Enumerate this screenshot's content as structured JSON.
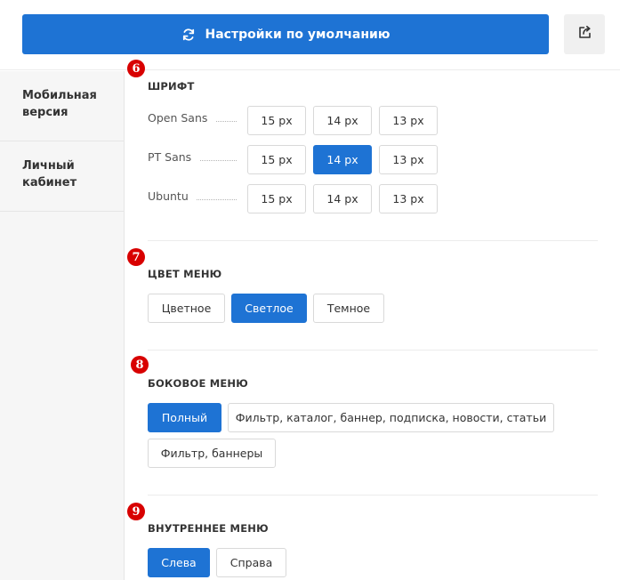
{
  "header": {
    "reset_label": "Настройки по умолчанию"
  },
  "sidebar": {
    "items": [
      {
        "line1": "Мобильная",
        "line2": "версия"
      },
      {
        "line1": "Личный",
        "line2": "кабинет"
      }
    ]
  },
  "sections": {
    "font": {
      "badge": "6",
      "title": "ШРИФТ",
      "rows": [
        {
          "name": "Open Sans",
          "sizes": [
            "15 px",
            "14 px",
            "13 px"
          ],
          "selected": null
        },
        {
          "name": "PT Sans",
          "sizes": [
            "15 px",
            "14 px",
            "13 px"
          ],
          "selected": "14 px"
        },
        {
          "name": "Ubuntu",
          "sizes": [
            "15 px",
            "14 px",
            "13 px"
          ],
          "selected": null
        }
      ]
    },
    "menu_color": {
      "badge": "7",
      "title": "ЦВЕТ МЕНЮ",
      "options": [
        "Цветное",
        "Светлое",
        "Темное"
      ],
      "selected": "Светлое"
    },
    "side_menu": {
      "badge": "8",
      "title": "БОКОВОЕ МЕНЮ",
      "options": [
        "Полный",
        "Фильтр, каталог, баннер, подписка, новости, статьи",
        "Фильтр, баннеры"
      ],
      "selected": "Полный"
    },
    "inner_menu": {
      "badge": "9",
      "title": "ВНУТРЕННЕЕ МЕНЮ",
      "options": [
        "Слева",
        "Справа"
      ],
      "selected": "Слева"
    }
  },
  "colors": {
    "accent": "#1e73d4",
    "badge": "#d80000"
  },
  "icons": {
    "reset": "refresh-icon",
    "share": "share-icon"
  }
}
